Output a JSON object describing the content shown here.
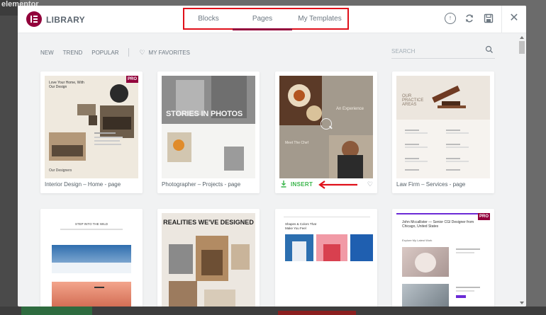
{
  "background": {
    "logo_text": "elementor"
  },
  "header": {
    "title": "LIBRARY",
    "tabs": [
      {
        "label": "Blocks"
      },
      {
        "label": "Pages",
        "active": true
      },
      {
        "label": "My Templates"
      }
    ],
    "icons": [
      "info-icon",
      "sync-icon",
      "save-icon",
      "close-icon"
    ],
    "info_glyph": "↑",
    "close_glyph": "✕"
  },
  "toolbar": {
    "filters": [
      "NEW",
      "TREND",
      "POPULAR"
    ],
    "favorites": "MY FAVORITES",
    "heart_glyph": "♡",
    "search_placeholder": "SEARCH"
  },
  "templates": [
    {
      "label": "Interior Design – Home - page",
      "pro": true
    },
    {
      "label": "Photographer – Projects - page",
      "pro": false
    },
    {
      "label": "",
      "pro": false,
      "hovered": true
    },
    {
      "label": "Law Firm – Services - page",
      "pro": false
    },
    {
      "label": "",
      "pro": false
    },
    {
      "label": "",
      "pro": false
    },
    {
      "label": "",
      "pro": false
    },
    {
      "label": "",
      "pro": true
    }
  ],
  "hover_card": {
    "insert_label": "INSERT",
    "heart_glyph": "♡"
  },
  "thumb_text": {
    "interior_headline": "Love Your Home, With Our Design",
    "interior_designers": "Our Designers",
    "photo_headline": "STORIES IN PHOTOS",
    "restaurant_headline": "An Experience",
    "restaurant_chef": "Meet The Chef",
    "law_headline": "OUR PRACTICE AREAS",
    "wild_headline": "STEP INTO THE WILD",
    "realities_headline": "REALITIES WE'VE DESIGNED",
    "shapes_headline": "Shapes & Colors That Make You Feel",
    "cgi_headline": "John Mccallister — Senior CGI Designer from Chicago, United States",
    "cgi_sub": "Explore My Latest Work"
  },
  "pro_label": "PRO",
  "colors": {
    "brand": "#92003b",
    "highlight": "#e0101a",
    "insert": "#39b54a"
  }
}
